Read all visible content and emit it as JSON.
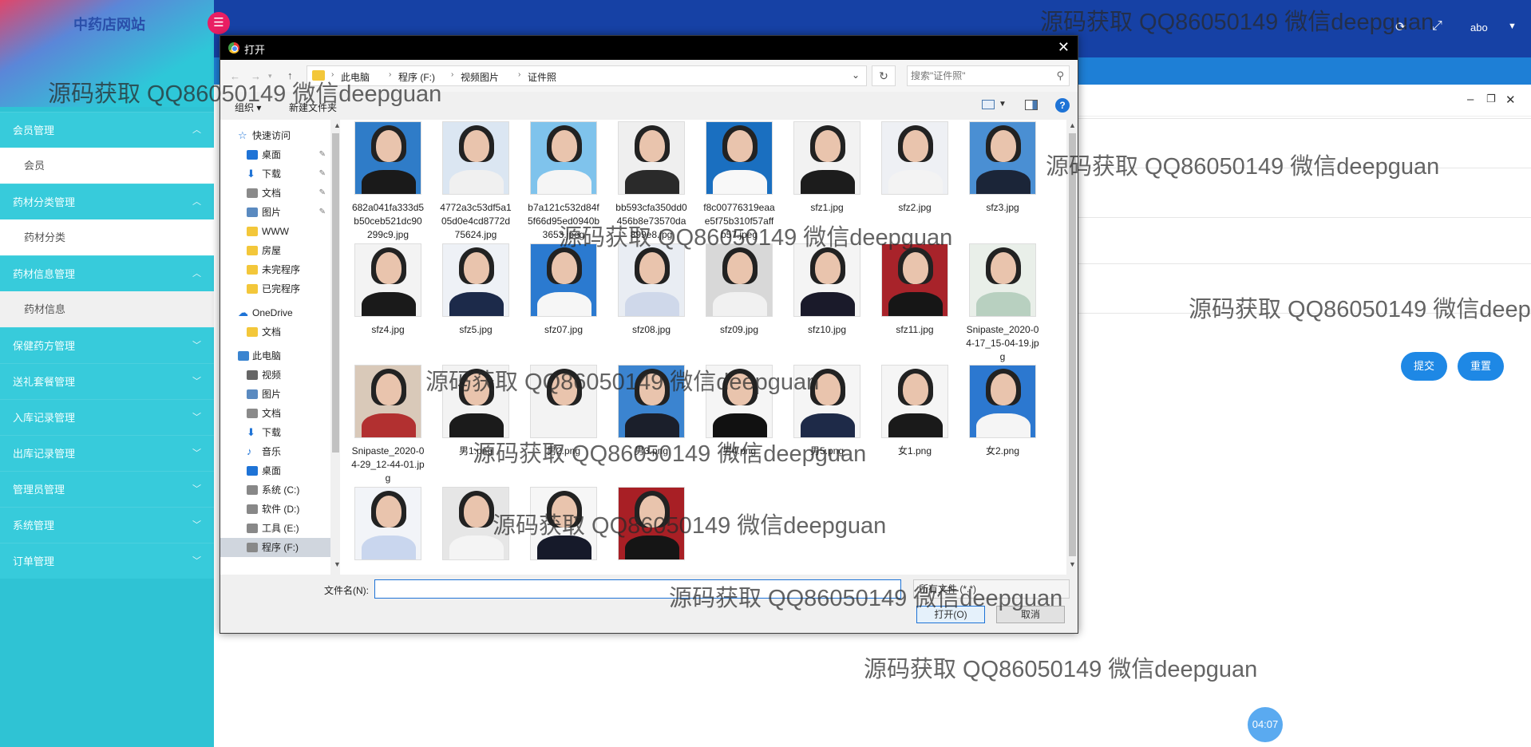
{
  "app": {
    "title": "中药店网站",
    "user": "abo"
  },
  "sidebar": {
    "groups": [
      {
        "label": "会员管理",
        "expanded": true,
        "items": [
          "会员"
        ]
      },
      {
        "label": "药材分类管理",
        "expanded": true,
        "items": [
          "药材分类"
        ]
      },
      {
        "label": "药材信息管理",
        "expanded": true,
        "items": [
          "药材信息"
        ]
      },
      {
        "label": "保健药方管理",
        "expanded": false,
        "items": []
      },
      {
        "label": "送礼套餐管理",
        "expanded": false,
        "items": []
      },
      {
        "label": "入库记录管理",
        "expanded": false,
        "items": []
      },
      {
        "label": "出库记录管理",
        "expanded": false,
        "items": []
      },
      {
        "label": "管理员管理",
        "expanded": false,
        "items": []
      },
      {
        "label": "系统管理",
        "expanded": false,
        "items": []
      },
      {
        "label": "订单管理",
        "expanded": false,
        "items": []
      }
    ]
  },
  "form": {
    "submit_label": "提交",
    "reset_label": "重置"
  },
  "timer": "04:07",
  "dialog": {
    "title": "打开",
    "breadcrumb": [
      "此电脑",
      "程序 (F:)",
      "视频图片",
      "证件照"
    ],
    "search_placeholder": "搜索\"证件照\"",
    "organize_label": "组织 ▾",
    "new_folder_label": "新建文件夹",
    "nav": [
      {
        "label": "快速访问",
        "icon": "star-icon",
        "level": 0,
        "pinned": false
      },
      {
        "label": "桌面",
        "icon": "desktop-icon",
        "level": 1,
        "pinned": true
      },
      {
        "label": "下载",
        "icon": "download-icon",
        "level": 1,
        "pinned": true
      },
      {
        "label": "文档",
        "icon": "document-icon",
        "level": 1,
        "pinned": true
      },
      {
        "label": "图片",
        "icon": "picture-icon",
        "level": 1,
        "pinned": true
      },
      {
        "label": "WWW",
        "icon": "folder-icon",
        "level": 1,
        "pinned": false
      },
      {
        "label": "房屋",
        "icon": "folder-icon",
        "level": 1,
        "pinned": false
      },
      {
        "label": "未完程序",
        "icon": "folder-icon",
        "level": 1,
        "pinned": false
      },
      {
        "label": "已完程序",
        "icon": "folder-icon",
        "level": 1,
        "pinned": false
      },
      {
        "label": "OneDrive",
        "icon": "cloud-icon",
        "level": 0,
        "pinned": false
      },
      {
        "label": "文档",
        "icon": "folder-icon",
        "level": 1,
        "pinned": false
      },
      {
        "label": "此电脑",
        "icon": "computer-icon",
        "level": 0,
        "pinned": false
      },
      {
        "label": "视频",
        "icon": "video-icon",
        "level": 1,
        "pinned": false
      },
      {
        "label": "图片",
        "icon": "picture-icon",
        "level": 1,
        "pinned": false
      },
      {
        "label": "文档",
        "icon": "document-icon",
        "level": 1,
        "pinned": false
      },
      {
        "label": "下载",
        "icon": "download-icon",
        "level": 1,
        "pinned": false
      },
      {
        "label": "音乐",
        "icon": "music-icon",
        "level": 1,
        "pinned": false
      },
      {
        "label": "桌面",
        "icon": "desktop-icon",
        "level": 1,
        "pinned": false
      },
      {
        "label": "系统 (C:)",
        "icon": "drive-icon",
        "level": 1,
        "pinned": false
      },
      {
        "label": "软件 (D:)",
        "icon": "drive-icon",
        "level": 1,
        "pinned": false
      },
      {
        "label": "工具 (E:)",
        "icon": "drive-icon",
        "level": 1,
        "pinned": false
      },
      {
        "label": "程序 (F:)",
        "icon": "drive-icon",
        "level": 1,
        "pinned": false,
        "selected": true
      }
    ],
    "files": [
      {
        "name": "682a041fa333d5b50ceb521dc90299c9.jpg",
        "bg": "#2f7cc8",
        "cloth": "#1a1a1a"
      },
      {
        "name": "4772a3c53df5a105d0e4cd8772d75624.jpg",
        "bg": "#dbe6f2",
        "cloth": "#f0f0f0"
      },
      {
        "name": "b7a121c532d84f5f66d95ed0940b3653.jpeg",
        "bg": "#7fc3ec",
        "cloth": "#f5f5f5"
      },
      {
        "name": "bb593cfa350dd0456b8e73570da899e8.jpg",
        "bg": "#efefef",
        "cloth": "#2a2a2a"
      },
      {
        "name": "f8c00776319eaae5f75b310f57affb57.jpeg",
        "bg": "#1a6fc0",
        "cloth": "#f8f8f8"
      },
      {
        "name": "sfz1.jpg",
        "bg": "#f2f2f2",
        "cloth": "#1c1c1c"
      },
      {
        "name": "sfz2.jpg",
        "bg": "#eef0f4",
        "cloth": "#f3f3f3"
      },
      {
        "name": "sfz3.jpg",
        "bg": "#4a8fd3",
        "cloth": "#1b2538"
      },
      {
        "name": "sfz4.jpg",
        "bg": "#f3f3f3",
        "cloth": "#1a1a1a"
      },
      {
        "name": "sfz5.jpg",
        "bg": "#eef1f6",
        "cloth": "#1c2a4a"
      },
      {
        "name": "sfz07.jpg",
        "bg": "#2b7ad0",
        "cloth": "#f6f6f6"
      },
      {
        "name": "sfz08.jpg",
        "bg": "#e9edf3",
        "cloth": "#cfd8ea"
      },
      {
        "name": "sfz09.jpg",
        "bg": "#d8d8d8",
        "cloth": "#f1f1f1"
      },
      {
        "name": "sfz10.jpg",
        "bg": "#f4f4f4",
        "cloth": "#1a1a2a"
      },
      {
        "name": "sfz11.jpg",
        "bg": "#a8232a",
        "cloth": "#161616"
      },
      {
        "name": "Snipaste_2020-04-17_15-04-19.jpg",
        "bg": "#e9efe9",
        "cloth": "#b8d0c0"
      },
      {
        "name": "Snipaste_2020-04-29_12-44-01.jpg",
        "bg": "#d9c9b9",
        "cloth": "#b23030"
      },
      {
        "name": "男1.png",
        "bg": "#f3f3f3",
        "cloth": "#1b1b1b"
      },
      {
        "name": "男2.png",
        "bg": "#f3f3f3",
        "cloth": "#f3f3f3"
      },
      {
        "name": "男3.png",
        "bg": "#3b84d0",
        "cloth": "#1b1f2b"
      },
      {
        "name": "男4.png",
        "bg": "#f5f5f5",
        "cloth": "#111111"
      },
      {
        "name": "男5.png",
        "bg": "#f5f5f5",
        "cloth": "#1e2a48"
      },
      {
        "name": "女1.png",
        "bg": "#f5f5f5",
        "cloth": "#1a1a1a"
      },
      {
        "name": "女2.png",
        "bg": "#2c78d0",
        "cloth": "#f5f5f5"
      },
      {
        "name": "",
        "bg": "#f2f4f8",
        "cloth": "#c9d6ee"
      },
      {
        "name": "",
        "bg": "#e6e6e6",
        "cloth": "#f4f4f4"
      },
      {
        "name": "",
        "bg": "#f6f6f6",
        "cloth": "#161a2a"
      },
      {
        "name": "",
        "bg": "#a81f25",
        "cloth": "#151515"
      }
    ],
    "filename_label": "文件名(N):",
    "filename_value": "",
    "filter_label": "所有文件 (*.*)",
    "open_label": "打开(O)",
    "cancel_label": "取消"
  },
  "watermark": "源码获取 QQ86050149 微信deepguan"
}
